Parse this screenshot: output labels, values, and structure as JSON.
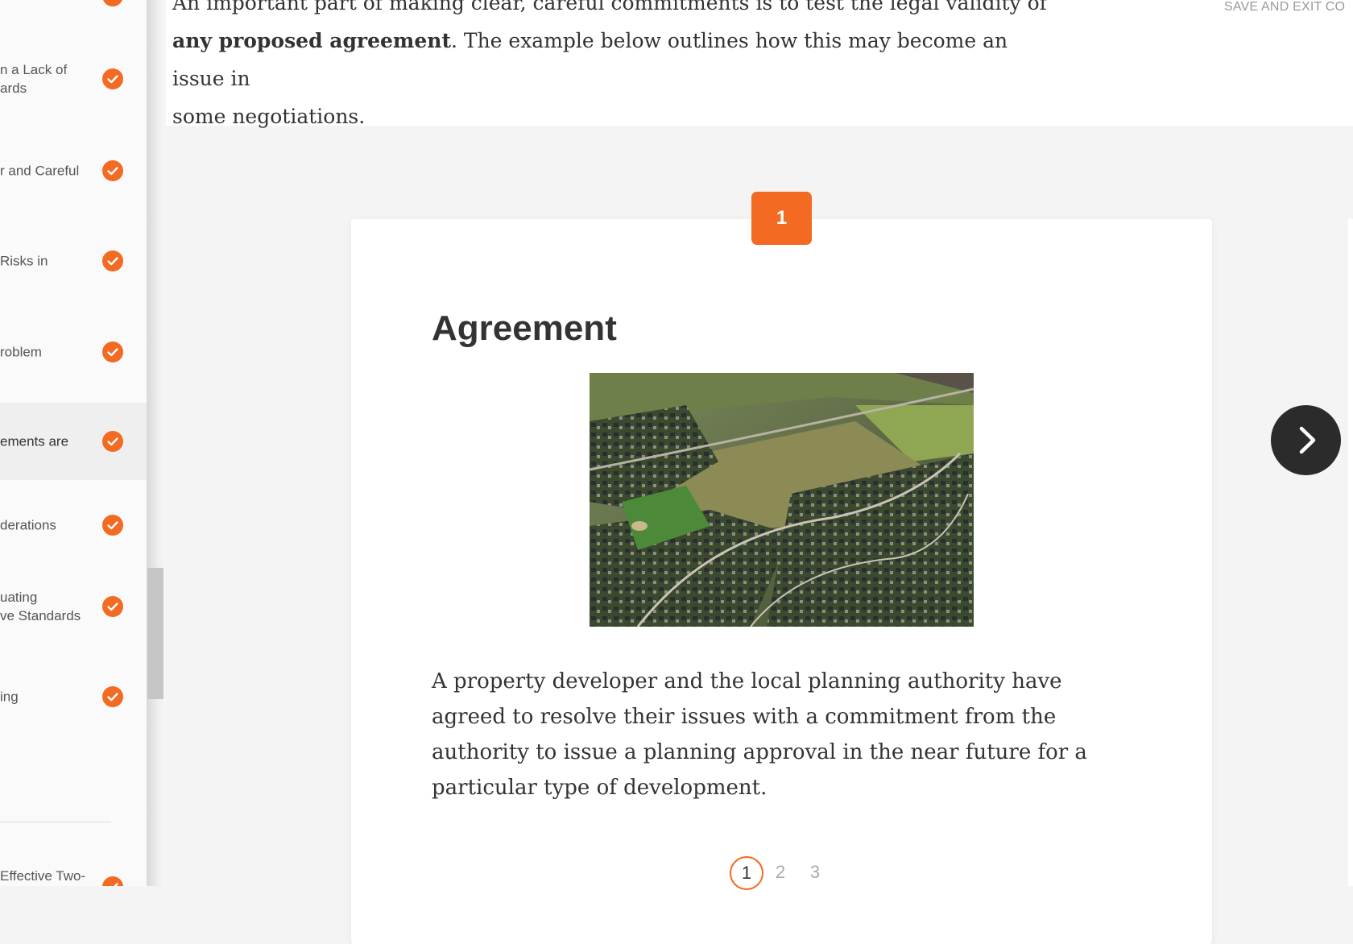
{
  "sidebar": {
    "items": [
      {
        "label": "n a Lack of\nards",
        "completed": true
      },
      {
        "label": "r and Careful",
        "completed": true
      },
      {
        "label": "Risks in",
        "completed": true
      },
      {
        "label": "roblem",
        "completed": true
      },
      {
        "label": "ements are",
        "completed": true,
        "active": true
      },
      {
        "label": "derations",
        "completed": true
      },
      {
        "label": "uating\nve Standards",
        "completed": true
      },
      {
        "label": "ing",
        "completed": true
      },
      {
        "label": "Effective Two-",
        "completed": true
      }
    ]
  },
  "header": {
    "intro_line1_partial": "An important part of making clear, careful commitments is to test the legal validity of",
    "intro_bold": "any proposed agreement",
    "intro_rest": ". The example below outlines how this may become an issue in",
    "intro_line3": "some negotiations.",
    "save_exit": "SAVE AND EXIT CO"
  },
  "card": {
    "step_number": "1",
    "title": "Agreement",
    "image_alt": "Aerial view of a suburban housing development beside open fields",
    "body": "A property developer and the local planning authority have agreed to resolve their issues with a commitment from the authority to issue a planning approval in the near future for a particular type of development."
  },
  "pagination": {
    "pages": [
      "1",
      "2",
      "3"
    ],
    "current": 1
  },
  "colors": {
    "accent": "#f36a22",
    "dark_button": "#2b2b2b",
    "text": "#333333"
  },
  "icons": {
    "check": "check-icon",
    "next": "chevron-right-icon"
  }
}
